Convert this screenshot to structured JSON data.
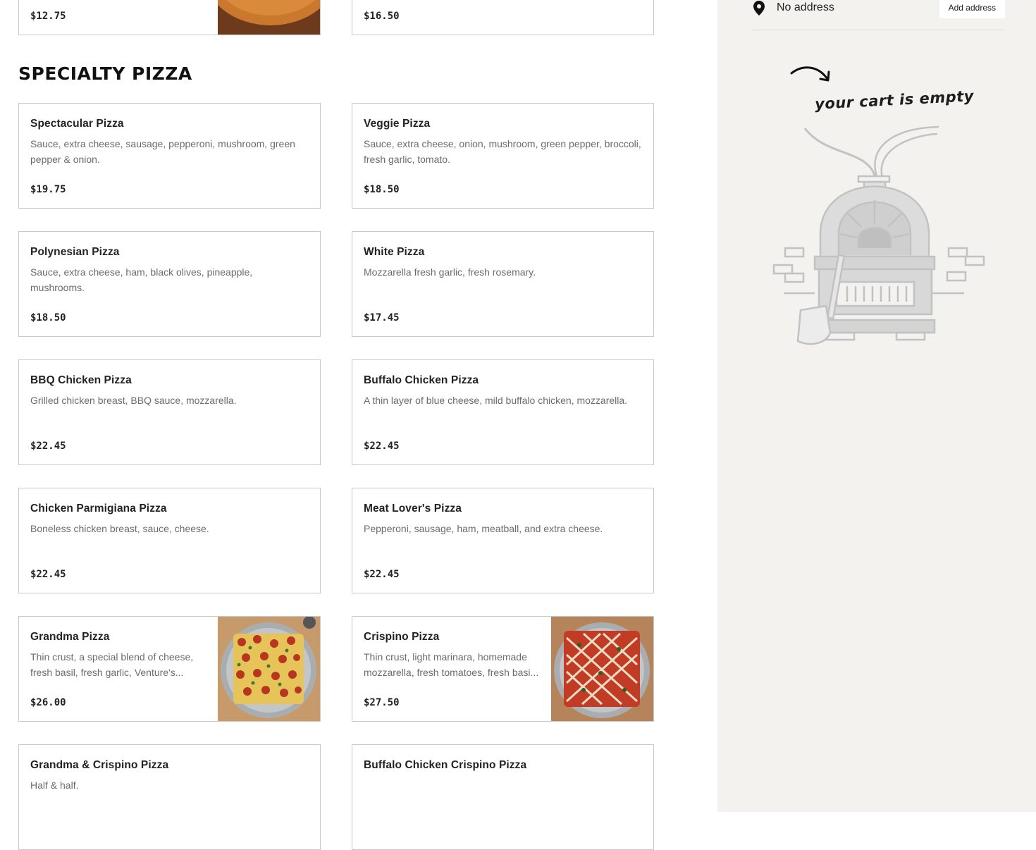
{
  "menu": {
    "top_prices": {
      "left": "$12.75",
      "right": "$16.50"
    },
    "section_title": "SPECIALTY PIZZA",
    "items": [
      {
        "name": "Spectacular Pizza",
        "desc": "Sauce, extra cheese, sausage, pepperoni, mushroom, green pepper & onion.",
        "price": "$19.75"
      },
      {
        "name": "Veggie Pizza",
        "desc": "Sauce, extra cheese, onion, mushroom, green pepper, broccoli, fresh garlic, tomato.",
        "price": "$18.50"
      },
      {
        "name": "Polynesian Pizza",
        "desc": "Sauce, extra cheese, ham, black olives, pineapple, mushrooms.",
        "price": "$18.50"
      },
      {
        "name": "White Pizza",
        "desc": "Mozzarella fresh garlic, fresh rosemary.",
        "price": "$17.45"
      },
      {
        "name": "BBQ Chicken Pizza",
        "desc": "Grilled chicken breast, BBQ sauce, mozzarella.",
        "price": "$22.45"
      },
      {
        "name": "Buffalo Chicken Pizza",
        "desc": "A thin layer of blue cheese, mild buffalo chicken, mozzarella.",
        "price": "$22.45"
      },
      {
        "name": "Chicken Parmigiana Pizza",
        "desc": "Boneless chicken breast, sauce, cheese.",
        "price": "$22.45"
      },
      {
        "name": "Meat Lover's Pizza",
        "desc": "Pepperoni, sausage, ham, meatball, and extra cheese.",
        "price": "$22.45"
      },
      {
        "name": "Grandma Pizza",
        "desc": "Thin crust, a special blend of cheese, fresh basil, fresh garlic, Venture's...",
        "price": "$26.00"
      },
      {
        "name": "Crispino Pizza",
        "desc": "Thin crust, light marinara, homemade mozzarella, fresh tomatoes, fresh basi...",
        "price": "$27.50"
      },
      {
        "name": "Grandma & Crispino Pizza",
        "desc": "Half & half.",
        "price": ""
      },
      {
        "name": "Buffalo Chicken Crispino Pizza",
        "desc": "",
        "price": ""
      }
    ]
  },
  "sidebar": {
    "address_label": "No address",
    "add_address_label": "Add address",
    "empty_cart_text": "your cart is empty",
    "icons": {
      "pin": "location-pin-icon",
      "arrow": "curved-arrow-icon",
      "illustration": "pizza-oven-illustration"
    }
  }
}
